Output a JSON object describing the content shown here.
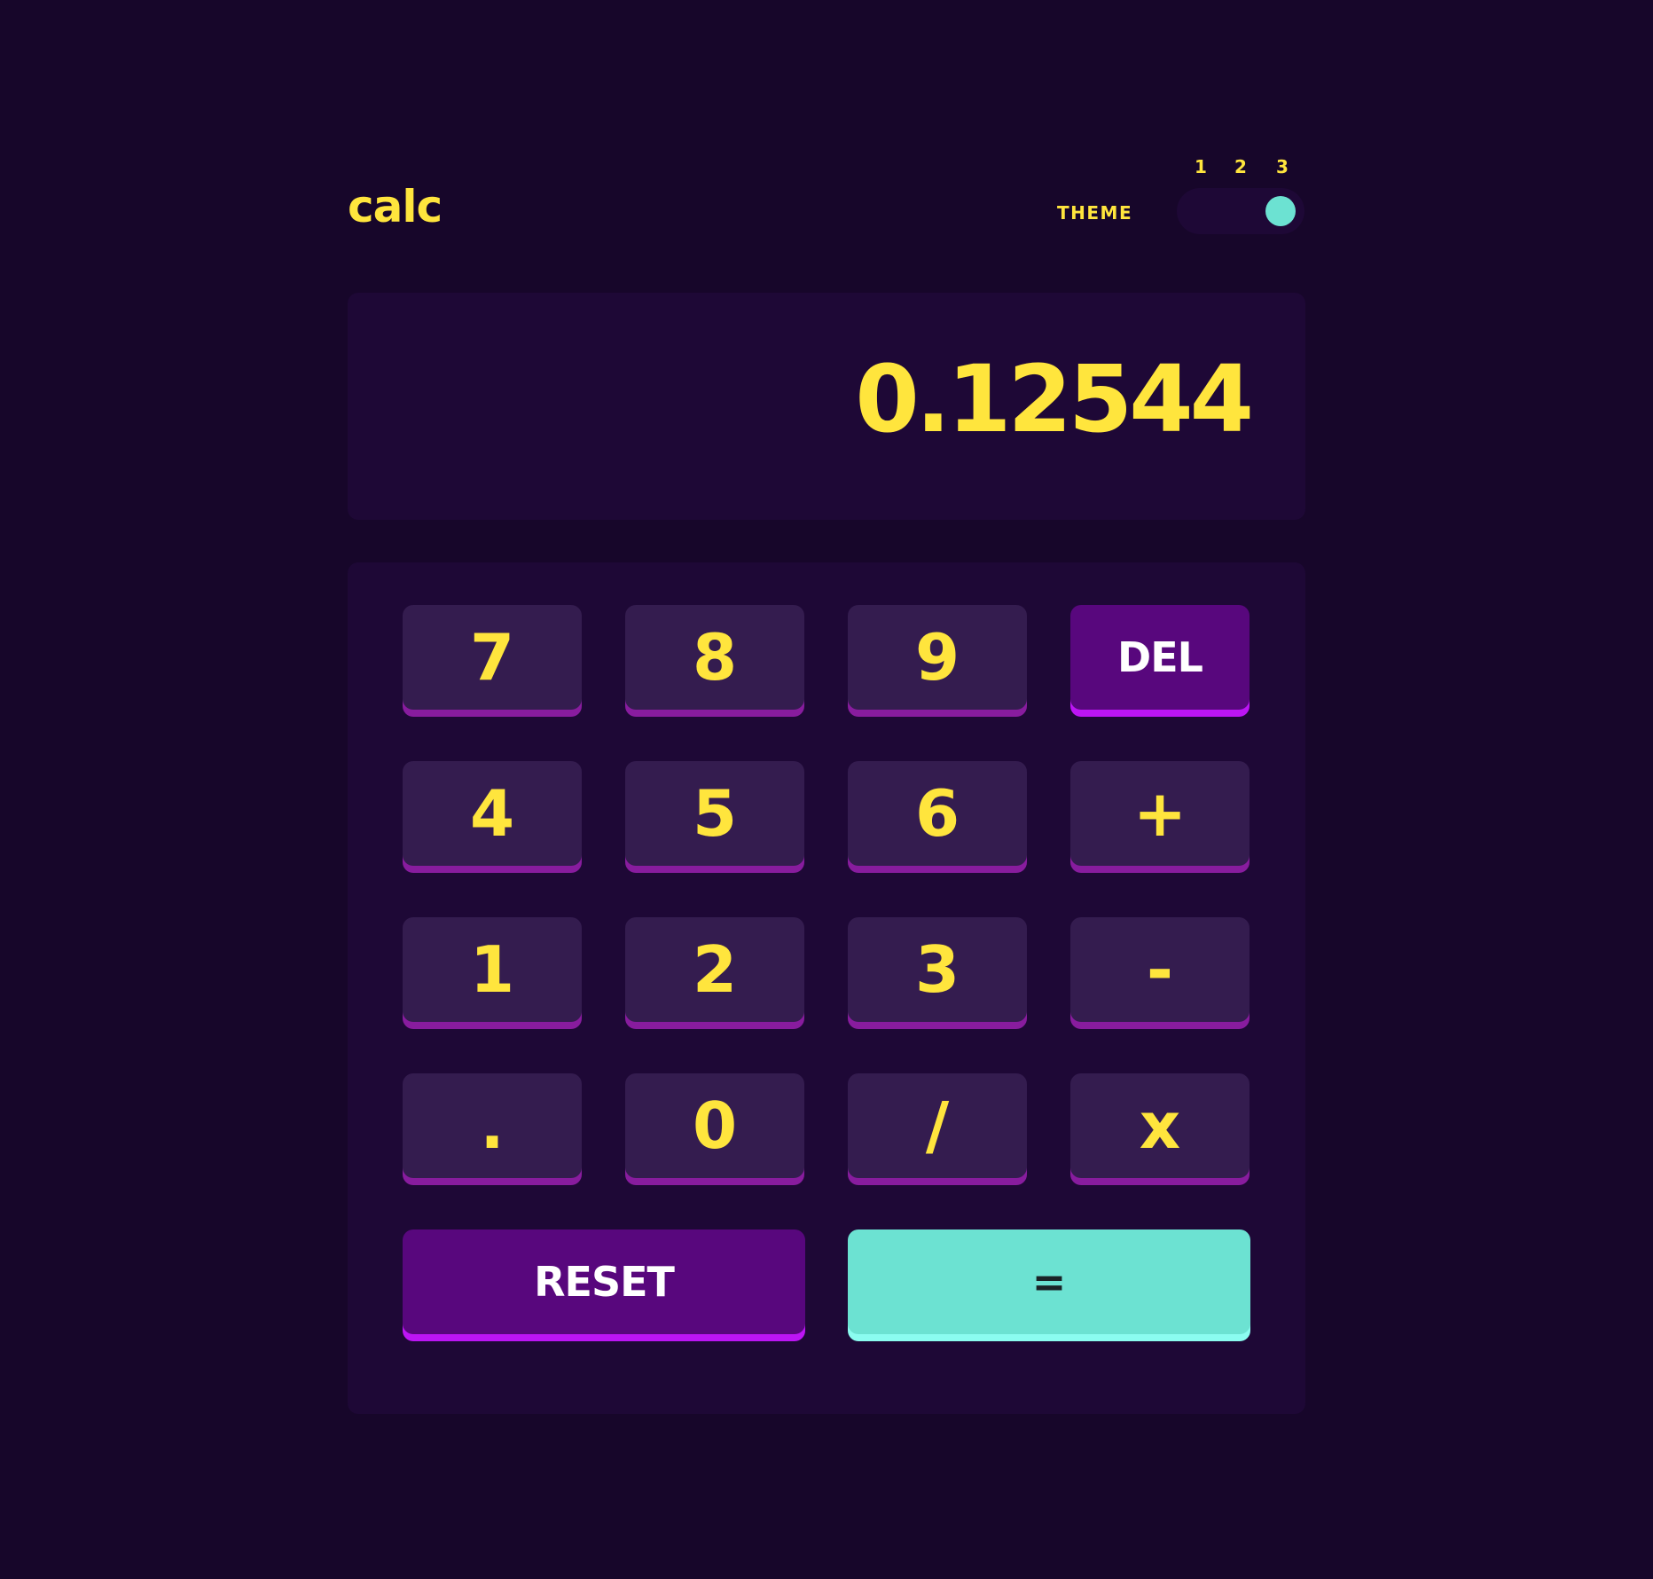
{
  "header": {
    "logo": "calc",
    "theme_label": "THEME",
    "theme_options": [
      "1",
      "2",
      "3"
    ],
    "selected_theme": "3"
  },
  "display": {
    "value": "0.12544"
  },
  "keypad": {
    "rows": [
      [
        "7",
        "8",
        "9",
        "DEL"
      ],
      [
        "4",
        "5",
        "6",
        "+"
      ],
      [
        "1",
        "2",
        "3",
        "-"
      ],
      [
        ".",
        "0",
        "/",
        "x"
      ]
    ],
    "reset_label": "RESET",
    "equals_label": "="
  },
  "colors": {
    "background": "#17062a",
    "accent_text": "#ffe53d",
    "key_bg": "#341c4f",
    "function_key_bg": "#58077d",
    "equals_key_bg": "#6ce2d2"
  }
}
